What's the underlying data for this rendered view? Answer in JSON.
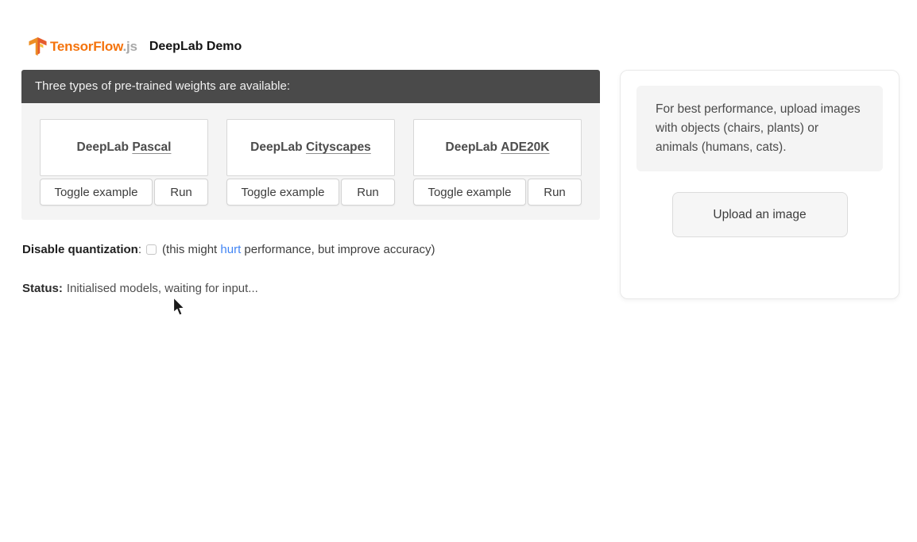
{
  "header": {
    "brand": "TensorFlow",
    "brand_suffix": ".js",
    "title": "DeepLab Demo"
  },
  "banner": {
    "text": "Three types of pre-trained weights are available:"
  },
  "models": {
    "prefix": "DeepLab",
    "items": [
      {
        "name": "Pascal",
        "toggle": "Toggle example",
        "run": "Run"
      },
      {
        "name": "Cityscapes",
        "toggle": "Toggle example",
        "run": "Run"
      },
      {
        "name": "ADE20K",
        "toggle": "Toggle example",
        "run": "Run"
      }
    ]
  },
  "quantization": {
    "label": "Disable quantization",
    "separator": ":",
    "checked": false,
    "note_pre": "(this might ",
    "link_text": "hurt",
    "note_post": " performance, but improve accuracy)"
  },
  "status": {
    "label": "Status:",
    "message": "Initialised models, waiting for input..."
  },
  "upload_panel": {
    "hint": "For best performance, upload images with objects (chairs, plants) or animals (humans, cats).",
    "button": "Upload an image"
  },
  "colors": {
    "banner_bg": "#4a4a4a",
    "section_bg": "#f4f4f4",
    "brand_orange": "#F4730C",
    "brand_suffix_gray": "#A9A9A9",
    "link_blue": "#4285F4",
    "logo_orange_dark": "#E55B2D",
    "logo_orange_light": "#ED8E24",
    "logo_orange_accent": "#F8BF3C"
  }
}
